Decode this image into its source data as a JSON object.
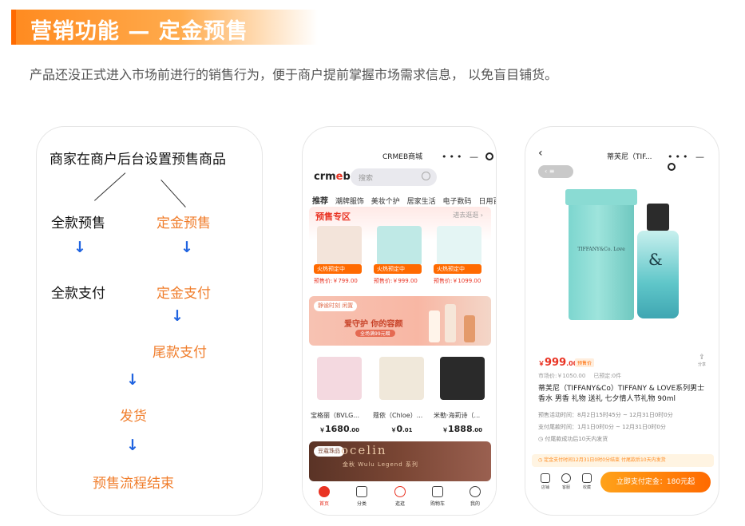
{
  "header": {
    "title": "营销功能 — 定金预售",
    "subtitle": "产品还没正式进入市场前进行的销售行为，便于商户提前掌握市场需求信息， 以免盲目铺货。"
  },
  "flow": {
    "root": "商家在商户后台设置预售商品",
    "left_1": "全款预售",
    "right_1": "定金预售",
    "left_2": "全款支付",
    "right_2": "定金支付",
    "right_3": "尾款支付",
    "step_ship": "发货",
    "step_end": "预售流程结束",
    "arrow": "↓"
  },
  "phone1": {
    "title": "CRMEB商城",
    "capsule": "•••  —",
    "logo_a": "crm",
    "logo_e": "e",
    "logo_b": "b",
    "search_placeholder": "搜索",
    "categories": [
      "推荐",
      "潮牌服饰",
      "美妆个护",
      "居家生活",
      "电子数码",
      "日用百"
    ],
    "presale_heading": "预售专区",
    "presale_more": "进去逛逛 ›",
    "presale_items": [
      {
        "badge": "火热预定中",
        "price": "预售价:￥799.00",
        "color": "#f3e4da"
      },
      {
        "badge": "火热预定中",
        "price": "预售价:￥999.00",
        "color": "#bfe9e6"
      },
      {
        "badge": "火热预定中",
        "price": "预售价:￥1099.00",
        "color": "#e4f5f4"
      }
    ],
    "banner1": {
      "tag": "静谧时刻",
      "tag2": "闲置",
      "headline": "爱守护 你的容颜",
      "sub": "全场满99元赠"
    },
    "goods": [
      {
        "name": "宝格丽（BVLG...",
        "price": "1680",
        "cents": ".00",
        "color": "#f4d9e0"
      },
      {
        "name": "蔻依（Chloe）...",
        "price": "0",
        "cents": ".01",
        "color": "#f0e8da"
      },
      {
        "name": "米勒·海莉诗（...",
        "price": "1888",
        "cents": ".00",
        "color": "#2a2a2a"
      }
    ],
    "currency": "￥",
    "banner2": {
      "tag": "豆蔻珠品",
      "brand": "ocelin",
      "series": "金秋 Wulu Legend 系列"
    },
    "tabs": [
      "首页",
      "分类",
      "逛逛",
      "购物车",
      "我的"
    ]
  },
  "phone2": {
    "title": "蒂芙尼（TIF...",
    "back": "‹",
    "capsule": "•••  —",
    "nav_pill": "‹ ≡",
    "box_label": "TIFFANY&Co. Love",
    "bottle_mark": "&",
    "price_symbol": "￥",
    "price": "999",
    "price_cents": ".00",
    "badge": "预售价",
    "share_label": "分享",
    "share_icon": "⇪",
    "market_price": "市场价:￥1050.00",
    "sold": "已预定:0件",
    "product_name": "蒂芙尼（TIFFANY&Co）TIFFANY & LOVE系列男士香水 男香 礼物 送礼 七夕情人节礼物 90ml",
    "presale_time": "预售活动时间：8月2日15时45分 ~ 12月31日0时0分",
    "final_payment_time": "支付尾款时间：1月1日0时0分 ~ 12月31日0时0分",
    "ship_note": "◷ 付尾款成功后10天内发货",
    "notice": "◷ 定金支付时间12月31日0时0分结束 付尾款后10天内发货",
    "bottom_icons": [
      "店铺",
      "客服",
      "收藏"
    ],
    "buy_button": "立即支付定金：180元起"
  }
}
